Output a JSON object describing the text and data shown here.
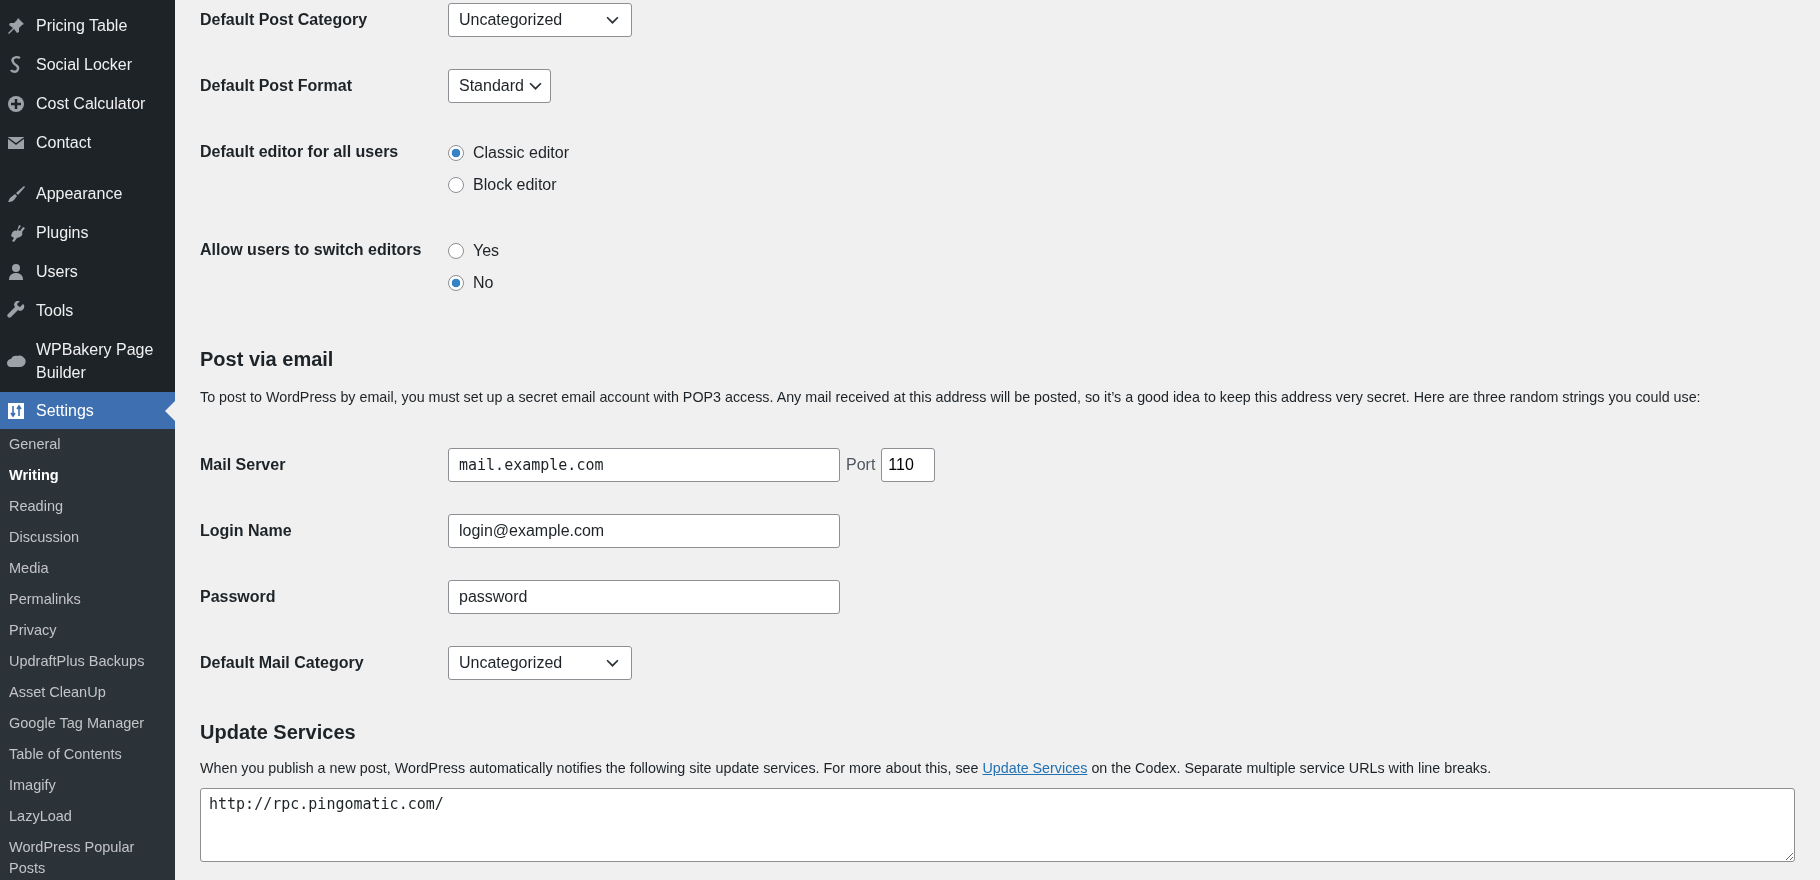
{
  "sidebar": {
    "menu_groups": [
      [
        {
          "label": "Pricing Table",
          "selected": false
        },
        {
          "label": "Social Locker",
          "selected": false
        },
        {
          "label": "Cost Calculator",
          "selected": false
        },
        {
          "label": "Contact",
          "selected": false
        }
      ],
      [
        {
          "label": "Appearance",
          "selected": false
        },
        {
          "label": "Plugins",
          "selected": false
        },
        {
          "label": "Users",
          "selected": false
        },
        {
          "label": "Tools",
          "selected": false
        },
        {
          "label": "WPBakery Page Builder",
          "selected": false
        },
        {
          "label": "Settings",
          "selected": true
        }
      ]
    ],
    "submenu": [
      {
        "label": "General",
        "selected": false
      },
      {
        "label": "Writing",
        "selected": true
      },
      {
        "label": "Reading",
        "selected": false
      },
      {
        "label": "Discussion",
        "selected": false
      },
      {
        "label": "Media",
        "selected": false
      },
      {
        "label": "Permalinks",
        "selected": false
      },
      {
        "label": "Privacy",
        "selected": false
      },
      {
        "label": "UpdraftPlus Backups",
        "selected": false
      },
      {
        "label": "Asset CleanUp",
        "selected": false
      },
      {
        "label": "Google Tag Manager",
        "selected": false
      },
      {
        "label": "Table of Contents",
        "selected": false
      },
      {
        "label": "Imagify",
        "selected": false
      },
      {
        "label": "LazyLoad",
        "selected": false
      },
      {
        "label": "WordPress Popular Posts",
        "selected": false
      }
    ]
  },
  "writing_settings": [
    {
      "kind": "select",
      "label": "Default Post Category",
      "value": "Uncategorized"
    },
    {
      "kind": "select",
      "label": "Default Post Format",
      "value": "Standard"
    },
    {
      "kind": "radio",
      "label": "Default editor for all users",
      "options": [
        {
          "label": "Classic editor",
          "selected": true
        },
        {
          "label": "Block editor",
          "selected": false
        }
      ]
    },
    {
      "kind": "radio",
      "label": "Allow users to switch editors",
      "options": [
        {
          "label": "Yes",
          "selected": false
        },
        {
          "label": "No",
          "selected": true
        }
      ]
    }
  ],
  "post_via_email": {
    "heading": "Post via email",
    "description": "To post to WordPress by email, you must set up a secret email account with POP3 access. Any mail received at this address will be posted, so it’s a good idea to keep this address very secret. Here are three random strings you could use:",
    "rows": [
      {
        "kind": "code",
        "label": "Mail Server",
        "value": "mail.example.com",
        "port_label": "Port",
        "port_value": "110"
      },
      {
        "kind": "text",
        "label": "Login Name",
        "value": "login@example.com"
      },
      {
        "kind": "text",
        "label": "Password",
        "value": "password"
      },
      {
        "kind": "select",
        "label": "Default Mail Category",
        "value": "Uncategorized"
      }
    ]
  },
  "update_services": {
    "heading": "Update Services",
    "description_before": "When you publish a new post, WordPress automatically notifies the following site update services. For more about this, see",
    "link": "Update Services",
    "description_after": "on the Codex. Separate multiple service URLs with line breaks.",
    "textarea_value": "http://rpc.pingomatic.com/"
  }
}
